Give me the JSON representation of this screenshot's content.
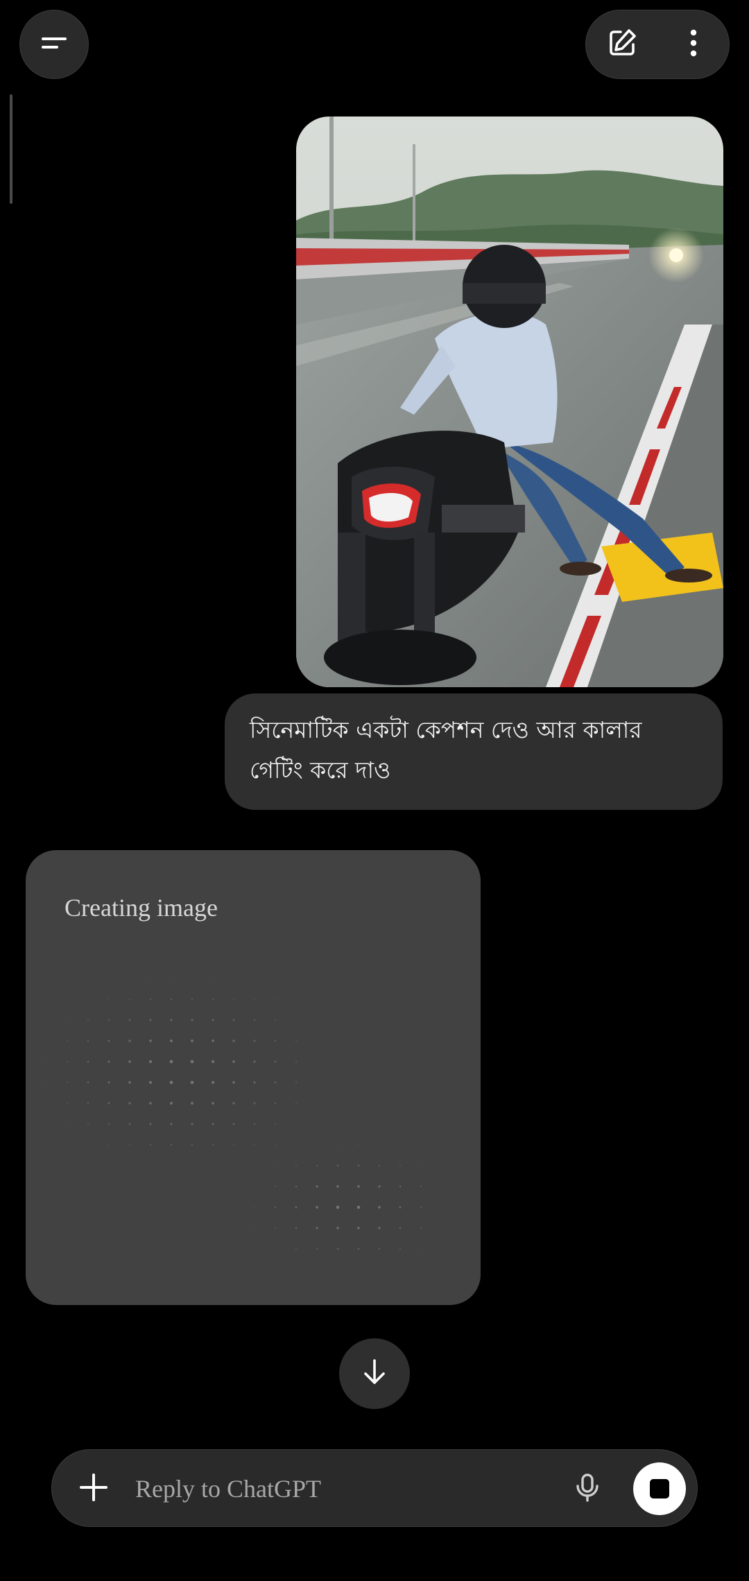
{
  "header": {
    "menu_icon": "menu-icon",
    "new_chat_icon": "edit-icon",
    "more_icon": "more-vertical-icon"
  },
  "conversation": {
    "user_image": {
      "icon": "photo-thumbnail"
    },
    "user_message": "সিনেমাটিক একটা কেপশন দেও আর কালার গেটিং করে দাও",
    "assistant": {
      "status": "Creating image"
    }
  },
  "scroll_down_icon": "arrow-down-icon",
  "composer": {
    "placeholder": "Reply to ChatGPT",
    "add_icon": "plus-icon",
    "mic_icon": "mic-icon",
    "stop_icon": "stop-icon"
  },
  "colors": {
    "background": "#000000",
    "surface": "#2a2a2a",
    "bubble": "#2f2f2f",
    "card": "#424242",
    "text": "#f2f2f2",
    "muted": "#a8a8a8"
  }
}
